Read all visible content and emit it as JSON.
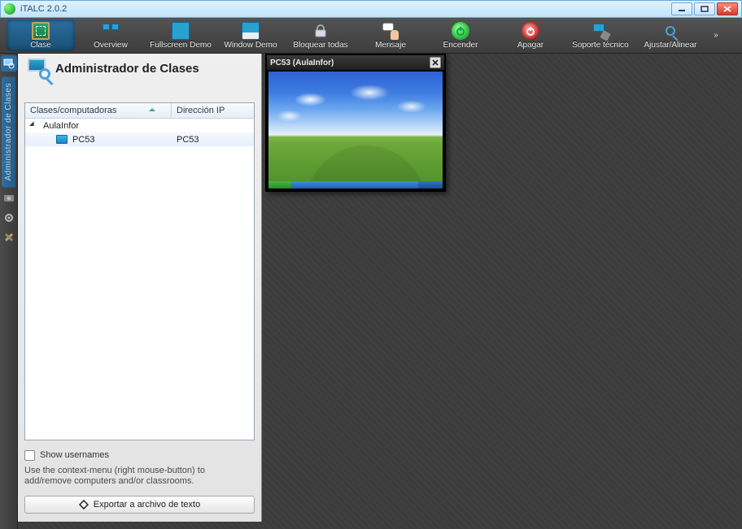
{
  "window": {
    "title": "iTALC 2.0.2"
  },
  "toolbar": {
    "items": [
      {
        "id": "clase",
        "label": "Clase",
        "icon": "board",
        "active": true
      },
      {
        "id": "overview",
        "label": "Overview",
        "icon": "overview",
        "active": false
      },
      {
        "id": "fullscreen",
        "label": "Fullscreen Demo",
        "icon": "fsdemo",
        "active": false
      },
      {
        "id": "windowdemo",
        "label": "Window Demo",
        "icon": "wdemo",
        "active": false
      },
      {
        "id": "lockall",
        "label": "Bloquear todas",
        "icon": "lock",
        "active": false
      },
      {
        "id": "message",
        "label": "Mensaje",
        "icon": "msg",
        "active": false
      },
      {
        "id": "poweron",
        "label": "Encender",
        "icon": "poweron",
        "active": false
      },
      {
        "id": "poweroff",
        "label": "Apagar",
        "icon": "poweroff",
        "active": false
      },
      {
        "id": "support",
        "label": "Soporte técnico",
        "icon": "support",
        "active": false
      },
      {
        "id": "adjust",
        "label": "Ajustar/Alinear",
        "icon": "adjust",
        "active": false
      }
    ]
  },
  "sidebar": {
    "vertical_label": "Administrador de Clases"
  },
  "panel": {
    "title": "Administrador de Clases",
    "columns": {
      "name": "Clases/computadoras",
      "ip": "Dirección IP"
    },
    "tree": {
      "group": "AulaInfor",
      "rows": [
        {
          "name": "PC53",
          "ip": "PC53"
        }
      ]
    },
    "show_usernames_label": "Show usernames",
    "hint": "Use the context-menu (right mouse-button) to add/remove computers and/or classrooms.",
    "export_label": "Exportar a archivo de texto"
  },
  "client": {
    "title": "PC53 (AulaInfor)"
  }
}
